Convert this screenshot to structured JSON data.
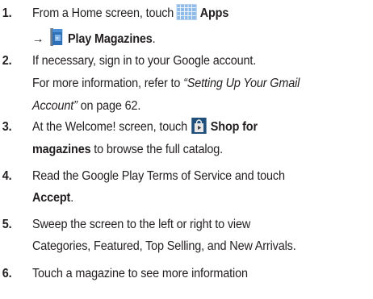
{
  "steps": [
    {
      "number": "1.",
      "line1": {
        "before": "From a Home screen, touch",
        "bold": "Apps"
      },
      "line2": {
        "arrow": "→",
        "bold": "Play Magazines",
        "after": "."
      }
    },
    {
      "number": "2.",
      "line1": "If necessary, sign in to your Google account.",
      "line2": {
        "before": "For more information, refer to ",
        "italic": "“Setting Up Your Gmail"
      },
      "line3": {
        "italic": "Account”",
        "after": "  on page 62."
      }
    },
    {
      "number": "3.",
      "line1": {
        "before": "At the Welcome! screen, touch",
        "bold": "Shop for"
      },
      "line2": {
        "bold": "magazines",
        "after": " to browse the full catalog."
      }
    },
    {
      "number": "4.",
      "line1": "Read the Google Play Terms of Service and touch",
      "line2": {
        "bold": "Accept",
        "after": "."
      }
    },
    {
      "number": "5.",
      "line1": "Sweep the screen to the left or right to view",
      "line2": "Categories, Featured, Top Selling, and New Arrivals."
    },
    {
      "number": "6.",
      "line1": "Touch a magazine to see more information"
    }
  ],
  "icons": {
    "apps": "apps-grid-icon",
    "magazines": "play-magazines-icon",
    "shop": "play-store-bag-icon"
  },
  "colors": {
    "text": "#231f20",
    "apps_icon": "#8fbbe8",
    "magazines_icon": "#2f6fb7",
    "shop_icon_bag": "#3a3a3a"
  }
}
